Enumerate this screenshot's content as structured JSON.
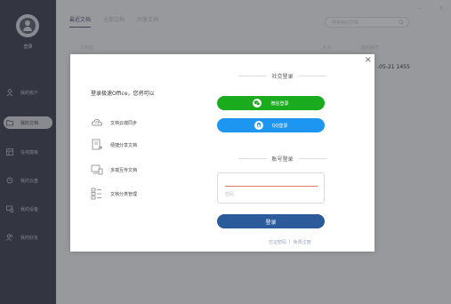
{
  "sidebar": {
    "login_label": "登录",
    "items": [
      {
        "label": "我的账户",
        "icon": "person-icon"
      },
      {
        "label": "我的文档",
        "icon": "folder-icon",
        "active": true
      },
      {
        "label": "在线模板",
        "icon": "template-icon"
      },
      {
        "label": "我的云盘",
        "icon": "cloud-icon"
      },
      {
        "label": "我的设备",
        "icon": "device-icon"
      },
      {
        "label": "我的好友",
        "icon": "friends-icon"
      }
    ]
  },
  "main": {
    "tabs": [
      {
        "label": "最近文档",
        "active": true
      },
      {
        "label": "全部文档"
      },
      {
        "label": "共享文档"
      }
    ],
    "search_placeholder": "搜索我的文档",
    "columns": {
      "name": "文档名",
      "size": "大小",
      "modified": "最后修改"
    },
    "rows": [
      {
        "date": "-05-21 1455"
      }
    ],
    "window_controls": {
      "minimize": "−",
      "close": "×"
    }
  },
  "modal": {
    "close_label": "×",
    "intro": "登录极速Office，您将可以",
    "features": [
      {
        "label": "文档云端同步",
        "icon": "cloud-sync-icon"
      },
      {
        "label": "便捷分享文档",
        "icon": "share-doc-icon"
      },
      {
        "label": "多端互传文档",
        "icon": "multi-device-icon"
      },
      {
        "label": "文档分类管理",
        "icon": "category-icon"
      }
    ],
    "social_title": "社交登录",
    "wechat_label": "微信登录",
    "qq_label": "QQ登录",
    "account_title": "账号登录",
    "password_placeholder": "密码",
    "login_button": "登录",
    "forgot_label": "忘记密码",
    "separator": "|",
    "register_label": "免费注册"
  },
  "colors": {
    "sidebar_bg": "#3c414d",
    "wechat": "#1aab1e",
    "qq": "#1c96f0",
    "login_button": "#2b5b9b",
    "input_accent": "#e2786f"
  }
}
